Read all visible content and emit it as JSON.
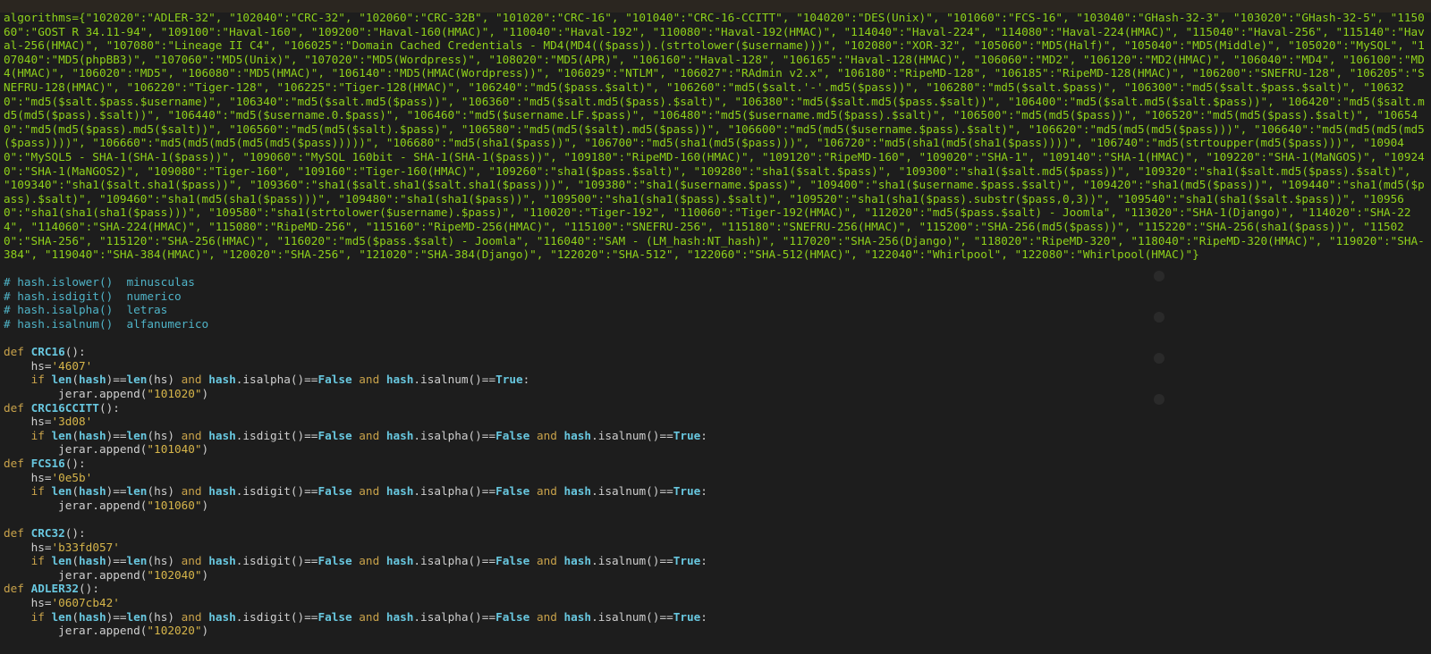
{
  "algorithms_text": "algorithms={\"102020\":\"ADLER-32\", \"102040\":\"CRC-32\", \"102060\":\"CRC-32B\", \"101020\":\"CRC-16\", \"101040\":\"CRC-16-CCITT\", \"104020\":\"DES(Unix)\", \"101060\":\"FCS-16\", \"103040\":\"GHash-32-3\", \"103020\":\"GHash-32-5\", \"115060\":\"GOST R 34.11-94\", \"109100\":\"Haval-160\", \"109200\":\"Haval-160(HMAC)\", \"110040\":\"Haval-192\", \"110080\":\"Haval-192(HMAC)\", \"114040\":\"Haval-224\", \"114080\":\"Haval-224(HMAC)\", \"115040\":\"Haval-256\", \"115140\":\"Haval-256(HMAC)\", \"107080\":\"Lineage II C4\", \"106025\":\"Domain Cached Credentials - MD4(MD4(($pass)).(strtolower($username)))\", \"102080\":\"XOR-32\", \"105060\":\"MD5(Half)\", \"105040\":\"MD5(Middle)\", \"105020\":\"MySQL\", \"107040\":\"MD5(phpBB3)\", \"107060\":\"MD5(Unix)\", \"107020\":\"MD5(Wordpress)\", \"108020\":\"MD5(APR)\", \"106160\":\"Haval-128\", \"106165\":\"Haval-128(HMAC)\", \"106060\":\"MD2\", \"106120\":\"MD2(HMAC)\", \"106040\":\"MD4\", \"106100\":\"MD4(HMAC)\", \"106020\":\"MD5\", \"106080\":\"MD5(HMAC)\", \"106140\":\"MD5(HMAC(Wordpress))\", \"106029\":\"NTLM\", \"106027\":\"RAdmin v2.x\", \"106180\":\"RipeMD-128\", \"106185\":\"RipeMD-128(HMAC)\", \"106200\":\"SNEFRU-128\", \"106205\":\"SNEFRU-128(HMAC)\", \"106220\":\"Tiger-128\", \"106225\":\"Tiger-128(HMAC)\", \"106240\":\"md5($pass.$salt)\", \"106260\":\"md5($salt.'-'.md5($pass))\", \"106280\":\"md5($salt.$pass)\", \"106300\":\"md5($salt.$pass.$salt)\", \"106320\":\"md5($salt.$pass.$username)\", \"106340\":\"md5($salt.md5($pass))\", \"106360\":\"md5($salt.md5($pass).$salt)\", \"106380\":\"md5($salt.md5($pass.$salt))\", \"106400\":\"md5($salt.md5($salt.$pass))\", \"106420\":\"md5($salt.md5(md5($pass).$salt))\", \"106440\":\"md5($username.0.$pass)\", \"106460\":\"md5($username.LF.$pass)\", \"106480\":\"md5($username.md5($pass).$salt)\", \"106500\":\"md5(md5($pass))\", \"106520\":\"md5(md5($pass).$salt)\", \"106540\":\"md5(md5($pass).md5($salt))\", \"106560\":\"md5(md5($salt).$pass)\", \"106580\":\"md5(md5($salt).md5($pass))\", \"106600\":\"md5(md5($username.$pass).$salt)\", \"106620\":\"md5(md5(md5($pass)))\", \"106640\":\"md5(md5(md5(md5($pass))))\", \"106660\":\"md5(md5(md5(md5(md5($pass)))))\", \"106680\":\"md5(sha1($pass))\", \"106700\":\"md5(sha1(md5($pass)))\", \"106720\":\"md5(sha1(md5(sha1($pass))))\", \"106740\":\"md5(strtoupper(md5($pass)))\", \"109040\":\"MySQL5 - SHA-1(SHA-1($pass))\", \"109060\":\"MySQL 160bit - SHA-1(SHA-1($pass))\", \"109180\":\"RipeMD-160(HMAC)\", \"109120\":\"RipeMD-160\", \"109020\":\"SHA-1\", \"109140\":\"SHA-1(HMAC)\", \"109220\":\"SHA-1(MaNGOS)\", \"109240\":\"SHA-1(MaNGOS2)\", \"109080\":\"Tiger-160\", \"109160\":\"Tiger-160(HMAC)\", \"109260\":\"sha1($pass.$salt)\", \"109280\":\"sha1($salt.$pass)\", \"109300\":\"sha1($salt.md5($pass))\", \"109320\":\"sha1($salt.md5($pass).$salt)\", \"109340\":\"sha1($salt.sha1($pass))\", \"109360\":\"sha1($salt.sha1($salt.sha1($pass)))\", \"109380\":\"sha1($username.$pass)\", \"109400\":\"sha1($username.$pass.$salt)\", \"109420\":\"sha1(md5($pass))\", \"109440\":\"sha1(md5($pass).$salt)\", \"109460\":\"sha1(md5(sha1($pass)))\", \"109480\":\"sha1(sha1($pass))\", \"109500\":\"sha1(sha1($pass).$salt)\", \"109520\":\"sha1(sha1($pass).substr($pass,0,3))\", \"109540\":\"sha1(sha1($salt.$pass))\", \"109560\":\"sha1(sha1(sha1($pass)))\", \"109580\":\"sha1(strtolower($username).$pass)\", \"110020\":\"Tiger-192\", \"110060\":\"Tiger-192(HMAC)\", \"112020\":\"md5($pass.$salt) - Joomla\", \"113020\":\"SHA-1(Django)\", \"114020\":\"SHA-224\", \"114060\":\"SHA-224(HMAC)\", \"115080\":\"RipeMD-256\", \"115160\":\"RipeMD-256(HMAC)\", \"115100\":\"SNEFRU-256\", \"115180\":\"SNEFRU-256(HMAC)\", \"115200\":\"SHA-256(md5($pass))\", \"115220\":\"SHA-256(sha1($pass))\", \"115020\":\"SHA-256\", \"115120\":\"SHA-256(HMAC)\", \"116020\":\"md5($pass.$salt) - Joomla\", \"116040\":\"SAM - (LM_hash:NT_hash)\", \"117020\":\"SHA-256(Django)\", \"118020\":\"RipeMD-320\", \"118040\":\"RipeMD-320(HMAC)\", \"119020\":\"SHA-384\", \"119040\":\"SHA-384(HMAC)\", \"120020\":\"SHA-256\", \"121020\":\"SHA-384(Django)\", \"122020\":\"SHA-512\", \"122060\":\"SHA-512(HMAC)\", \"122040\":\"Whirlpool\", \"122080\":\"Whirlpool(HMAC)\"}",
  "comments": [
    "# hash.islower()  minusculas",
    "# hash.isdigit()  numerico",
    "# hash.isalpha()  letras",
    "# hash.isalnum()  alfanumerico"
  ],
  "keywords": {
    "def": "def",
    "if": "if",
    "and": "and",
    "len": "len",
    "hash": "hash",
    "false": "False",
    "true": "True",
    "append_prefix": "jerar.append(",
    "hs_prefix": "hs="
  },
  "functions": [
    {
      "name": "CRC16",
      "hs": "'4607'",
      "checks": [
        "isalpha",
        "isalnum"
      ],
      "values": [
        "False",
        "True"
      ],
      "code": "\"101020\""
    },
    {
      "name": "CRC16CCITT",
      "hs": "'3d08'",
      "checks": [
        "isdigit",
        "isalpha",
        "isalnum"
      ],
      "values": [
        "False",
        "False",
        "True"
      ],
      "code": "\"101040\""
    },
    {
      "name": "FCS16",
      "hs": "'0e5b'",
      "checks": [
        "isdigit",
        "isalpha",
        "isalnum"
      ],
      "values": [
        "False",
        "False",
        "True"
      ],
      "code": "\"101060\""
    },
    {
      "name": "CRC32",
      "hs": "'b33fd057'",
      "checks": [
        "isdigit",
        "isalpha",
        "isalnum"
      ],
      "values": [
        "False",
        "False",
        "True"
      ],
      "code": "\"102040\""
    },
    {
      "name": "ADLER32",
      "hs": "'0607cb42'",
      "checks": [
        "isdigit",
        "isalpha",
        "isalnum"
      ],
      "values": [
        "False",
        "False",
        "True"
      ],
      "code": "\"102020\""
    }
  ],
  "colors": {
    "background": "#1d1d1d",
    "dict_text": "#8fd11b",
    "comment": "#4fb3c7",
    "keyword": "#c8a24a",
    "function_name": "#68c7df",
    "string": "#d6b54a"
  }
}
